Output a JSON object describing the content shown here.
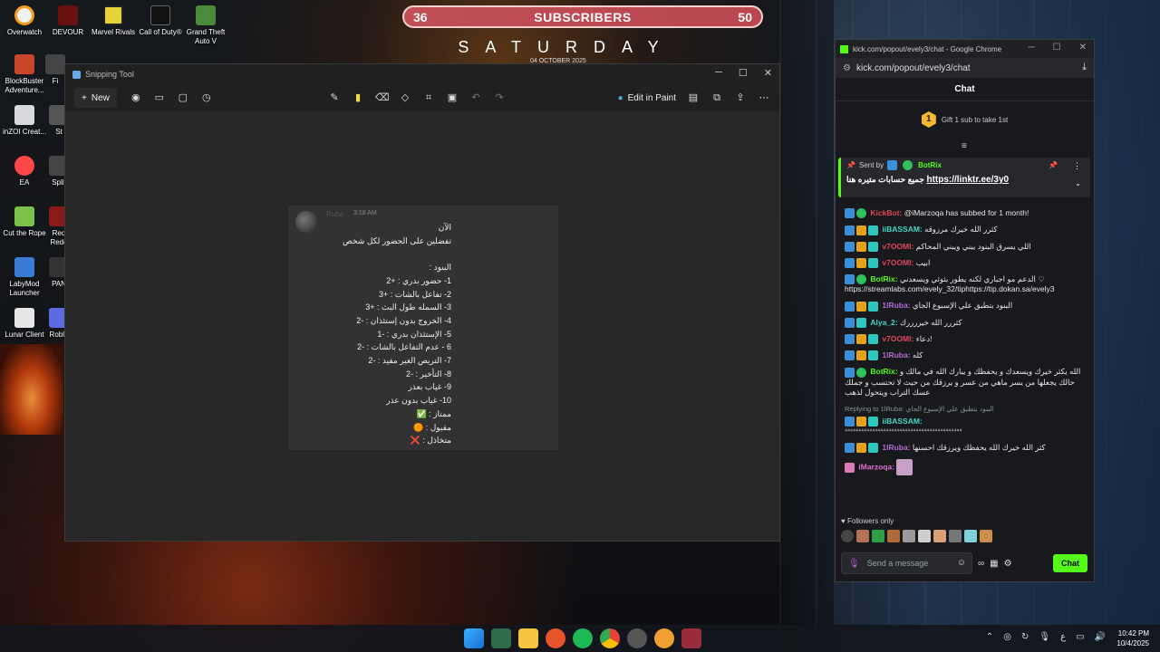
{
  "desktop": {
    "icons": [
      {
        "label": "Overwatch"
      },
      {
        "label": "DEVOUR"
      },
      {
        "label": "Marvel Rivals"
      },
      {
        "label": "Call of Duty®"
      },
      {
        "label": "Grand Theft Auto V"
      },
      {
        "label": "BlockBuster Adventure..."
      },
      {
        "label": "inZOI Creat..."
      },
      {
        "label": "EA"
      },
      {
        "label": "Cut the Rope"
      },
      {
        "label": "LabyMod Launcher"
      },
      {
        "label": "Lunar Client"
      },
      {
        "label": "Fi"
      },
      {
        "label": "St"
      },
      {
        "label": "Split"
      },
      {
        "label": "Red Rede"
      },
      {
        "label": "PAN"
      },
      {
        "label": "Roblo"
      }
    ]
  },
  "overlay": {
    "sub_left": "36",
    "sub_title": "SUBSCRIBERS",
    "sub_right": "50",
    "day": "SATURDAY",
    "date": "04 OCTOBER 2025"
  },
  "snipping_tool": {
    "title": "Snipping Tool",
    "new_label": "New",
    "edit_in_paint": "Edit in Paint",
    "image": {
      "username": "Ruba",
      "time": "3:18 AM",
      "lines": [
        "الآن",
        "تفضلين على الحضور لكل شخص",
        "",
        "البنود :",
        "1- حضور بدري : +2",
        "2- تفاعل بالشات : +3",
        "3- السمله طول البث : +3",
        "4- الخروج بدون إستئذان : -2",
        "5- الإستئذان بدري : -1",
        "6 - عدم التفاعل بالشات : -2",
        "7- التريص الغير مفيد : -2",
        "8- التأخير : -2",
        "9- غياب بعذر",
        "10- غياب بدون عذر",
        "ممتاز : ✅",
        "مقبول : 🟠",
        "متخاذل : ❌"
      ]
    }
  },
  "chat_window": {
    "title": "kick.com/popout/evely3/chat - Google Chrome",
    "url": "kick.com/popout/evely3/chat",
    "header": "Chat",
    "gift_count": "1",
    "gift_text": "Gift 1 sub to take 1st",
    "pinned": {
      "sent_by_prefix": "Sent by",
      "sender": "BotRix",
      "message": "جميع حسابات متيره هنا",
      "link": "https://linktr.ee/3y0"
    },
    "messages": [
      {
        "user": "KickBot:",
        "user_color": "#e0465a",
        "text": "@iMarzoqa has subbed for 1 month!"
      },
      {
        "user": "iiBASSAM:",
        "user_color": "#46d6c8",
        "text": "كثرر الله خيرك مرزوقه"
      },
      {
        "user": "v7OOMI:",
        "user_color": "#e0465a",
        "text": "اللي يسرق البنود يبني ويبني المحاكم"
      },
      {
        "user": "v7OOMI:",
        "user_color": "#e0465a",
        "text": "ابيب"
      },
      {
        "user": "BotRix:",
        "user_color": "#53fc18",
        "text": "الدعم مو اجباري لكنه يطور بثوثي ويسعدني ♡ https://streamlabs.com/evely_32/tiphttps://tip.dokan.sa/evely3"
      },
      {
        "user": "1lRuba:",
        "user_color": "#b06bd6",
        "text": "البنود بتطبق علي الإسبوع الجاي"
      },
      {
        "user": "Alya_2:",
        "user_color": "#46d6c8",
        "text": "كثررر الله خيررررك"
      },
      {
        "user": "v7OOMI:",
        "user_color": "#e0465a",
        "text": "دعاء!"
      },
      {
        "user": "1lRuba:",
        "user_color": "#b06bd6",
        "text": "كله"
      },
      {
        "user": "BotRix:",
        "user_color": "#53fc18",
        "text": "الله يكثر خيرك ويسعدك و يحفظك و يبارك الله في مالك و حالك يجعلها من يسر ماهي من عسر و يرزقك من حيث لا تحتسب و جملك عسك التراب ويتحول لذهب"
      },
      {
        "reply": "Replying to 1lRuba: البنود بتطبق علي الإسبوع الجاي",
        "user": "iiBASSAM:",
        "user_color": "#46d6c8",
        "text": "⁴⁴⁴⁴⁴⁴⁴⁴⁴⁴⁴⁴⁴⁴⁴⁴⁴⁴⁴⁴⁴⁴⁴⁴⁴⁴⁴⁴⁴⁴⁴⁴⁴⁴⁴⁴⁴⁴⁴⁴⁴⁴⁴"
      },
      {
        "user": "1lRuba:",
        "user_color": "#b06bd6",
        "text": "كثر الله خيرك الله يحفظك ويرزقك احسنها"
      },
      {
        "user": "iMarzoqa:",
        "user_color": "#e06fd0",
        "text": ""
      }
    ],
    "followers_only": "Followers only",
    "input_placeholder": "Send a message",
    "chat_button": "Chat"
  },
  "taskbar": {
    "time": "10:42 PM",
    "date": "10/4/2025"
  }
}
